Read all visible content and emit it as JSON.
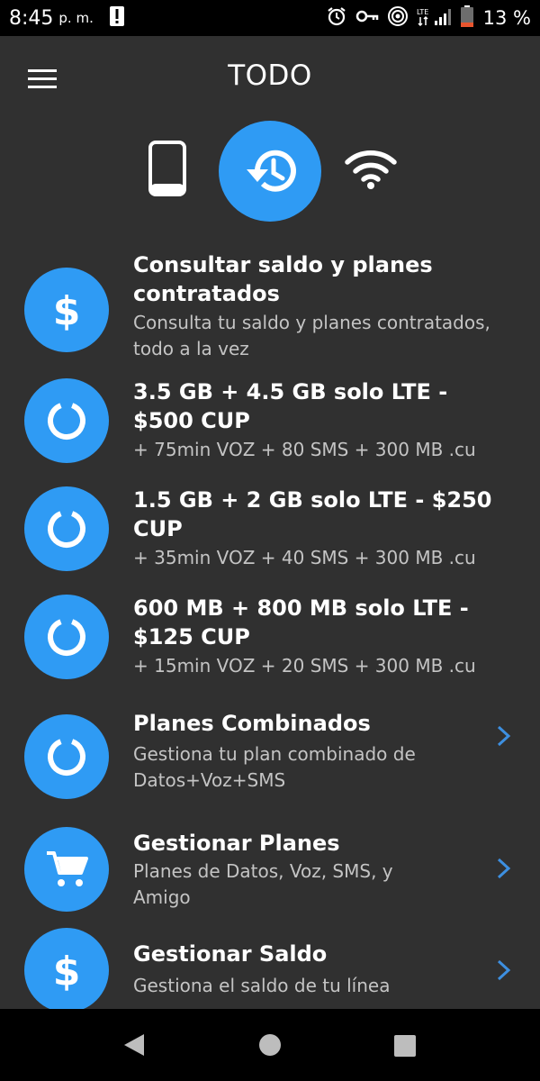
{
  "status_bar": {
    "time": "8:45",
    "ampm": "p. m.",
    "battery": "13 %",
    "icons": [
      "alert-icon",
      "alarm-icon",
      "vpn-key-icon",
      "hotspot-icon",
      "lte-signal-icon",
      "battery-low-icon"
    ]
  },
  "app_bar": {
    "title": "TODO",
    "menu_icon": "hamburger-menu-icon"
  },
  "tabs": [
    {
      "icon": "phone-icon",
      "selected": false
    },
    {
      "icon": "history-icon",
      "selected": true
    },
    {
      "icon": "wifi-icon",
      "selected": false
    }
  ],
  "items": [
    {
      "icon": "dollar-icon",
      "title": "Consultar saldo y planes contratados",
      "subtitle": "Consulta tu saldo y planes contratados, todo a la vez",
      "chevron": false
    },
    {
      "icon": "donut-progress-icon",
      "title": "3.5 GB + 4.5 GB solo LTE - $500 CUP",
      "subtitle": "+ 75min VOZ + 80 SMS + 300 MB .cu",
      "chevron": false
    },
    {
      "icon": "donut-progress-icon",
      "title": "1.5 GB + 2 GB solo LTE - $250 CUP",
      "subtitle": "+ 35min VOZ + 40 SMS + 300 MB .cu",
      "chevron": false
    },
    {
      "icon": "donut-progress-icon",
      "title": "600 MB + 800 MB solo LTE - $125 CUP",
      "subtitle": "+ 15min VOZ + 20 SMS + 300 MB .cu",
      "chevron": false
    },
    {
      "icon": "donut-progress-icon",
      "title": "Planes Combinados",
      "subtitle": "Gestiona tu plan combinado de Datos+Voz+SMS",
      "chevron": true
    },
    {
      "icon": "cart-icon",
      "title": "Gestionar Planes",
      "subtitle": "Planes de Datos, Voz, SMS, y Amigo",
      "chevron": true
    },
    {
      "icon": "dollar-icon",
      "title": "Gestionar Saldo",
      "subtitle": "Gestiona el saldo de tu línea",
      "chevron": true
    }
  ],
  "colors": {
    "background": "#303030",
    "accent": "#2f9bf4",
    "chevron": "#3d8fe0",
    "subtitle": "#c4c4c4"
  },
  "nav_bar": {
    "buttons": [
      "back-icon",
      "home-icon",
      "recents-icon"
    ]
  }
}
